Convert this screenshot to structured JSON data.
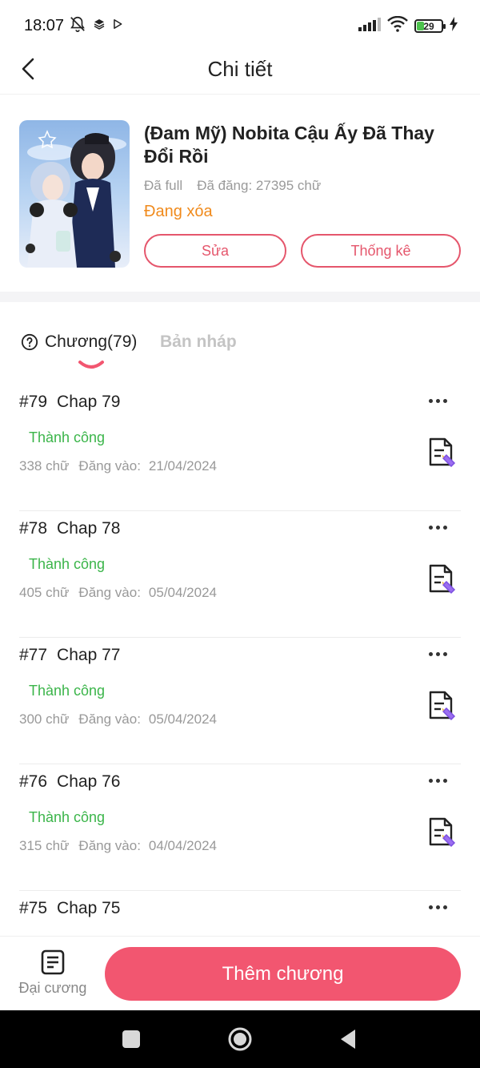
{
  "status_bar": {
    "time": "18:07",
    "battery": "29"
  },
  "header": {
    "title": "Chi tiết"
  },
  "story": {
    "title": "(Đam Mỹ) Nobita Cậu Ấy Đã Thay Đổi Rồi",
    "completion": "Đã full",
    "published_words": "Đã đăng: 27395 chữ",
    "status": "Đang xóa",
    "edit_label": "Sửa",
    "stats_label": "Thống kê"
  },
  "tabs": {
    "chapters": "Chương(79)",
    "drafts": "Bản nháp"
  },
  "chapters": [
    {
      "number": "#79",
      "name": "Chap 79",
      "status": "Thành công",
      "words": "338 chữ",
      "date_label": "Đăng vào:",
      "date": "21/04/2024"
    },
    {
      "number": "#78",
      "name": "Chap 78",
      "status": "Thành công",
      "words": "405 chữ",
      "date_label": "Đăng vào:",
      "date": "05/04/2024"
    },
    {
      "number": "#77",
      "name": "Chap 77",
      "status": "Thành công",
      "words": "300 chữ",
      "date_label": "Đăng vào:",
      "date": "05/04/2024"
    },
    {
      "number": "#76",
      "name": "Chap 76",
      "status": "Thành công",
      "words": "315 chữ",
      "date_label": "Đăng vào:",
      "date": "04/04/2024"
    },
    {
      "number": "#75",
      "name": "Chap 75"
    }
  ],
  "bottom_bar": {
    "outline_label": "Đại cương",
    "add_chapter_label": "Thêm chương"
  },
  "colors": {
    "accent": "#f25670",
    "success": "#3bb54a",
    "warning": "#f08a1c"
  }
}
